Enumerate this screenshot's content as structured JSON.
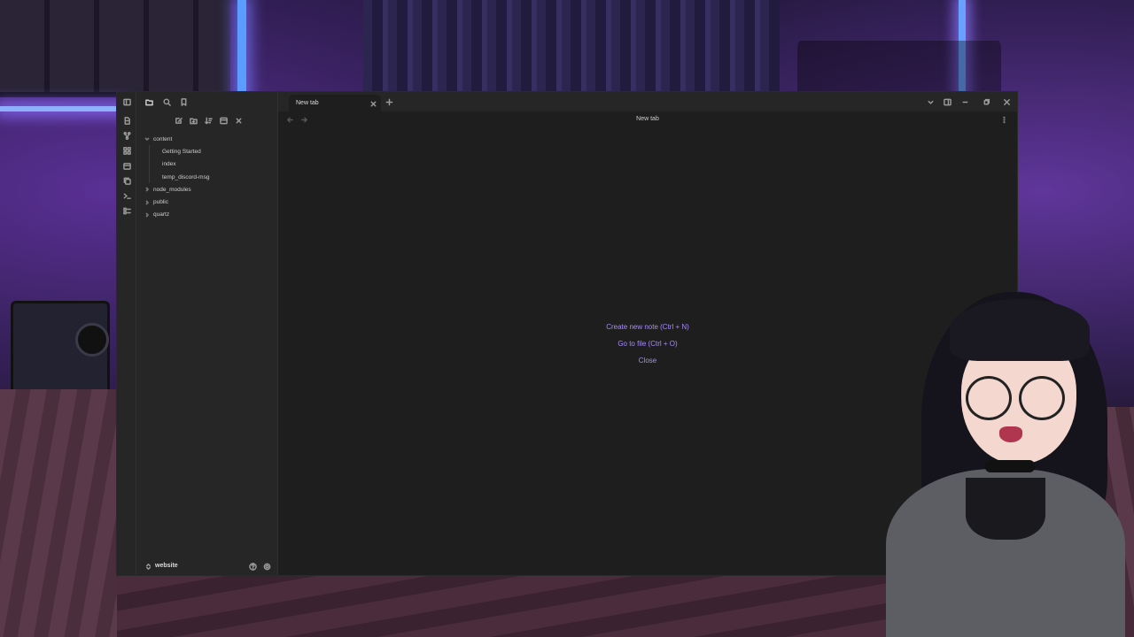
{
  "tabs": [
    {
      "title": "New tab",
      "active": true
    }
  ],
  "view": {
    "title": "New tab"
  },
  "empty_state": {
    "actions": [
      "Create new note (Ctrl + N)",
      "Go to file (Ctrl + O)",
      "Close"
    ]
  },
  "file_tree": {
    "folders": [
      {
        "label": "content",
        "expanded": true,
        "files": [
          "Getting Started",
          "index",
          "temp_discord-msg"
        ]
      },
      {
        "label": "node_modules",
        "expanded": false
      },
      {
        "label": "public",
        "expanded": false
      },
      {
        "label": "quartz",
        "expanded": false
      }
    ]
  },
  "vault": {
    "name": "website"
  },
  "colors": {
    "accent": "#a88bfa",
    "window_bg": "#1e1e1e",
    "sidebar_bg": "#262626"
  },
  "icons": {
    "ribbon": [
      "sidebar-toggle-icon",
      "file-icon",
      "graph-icon",
      "canvas-icon",
      "calendar-icon",
      "copy-icon",
      "terminal-icon",
      "checklist-icon"
    ],
    "sidebar_tabs": [
      "folder-icon",
      "search-icon",
      "bookmark-icon"
    ],
    "explorer_actions": [
      "new-note-icon",
      "new-folder-icon",
      "sort-icon",
      "collapse-icon",
      "close-icon"
    ],
    "window_controls": [
      "chevron-down-icon",
      "layout-icon",
      "minimize-icon",
      "maximize-icon",
      "close-icon"
    ]
  }
}
